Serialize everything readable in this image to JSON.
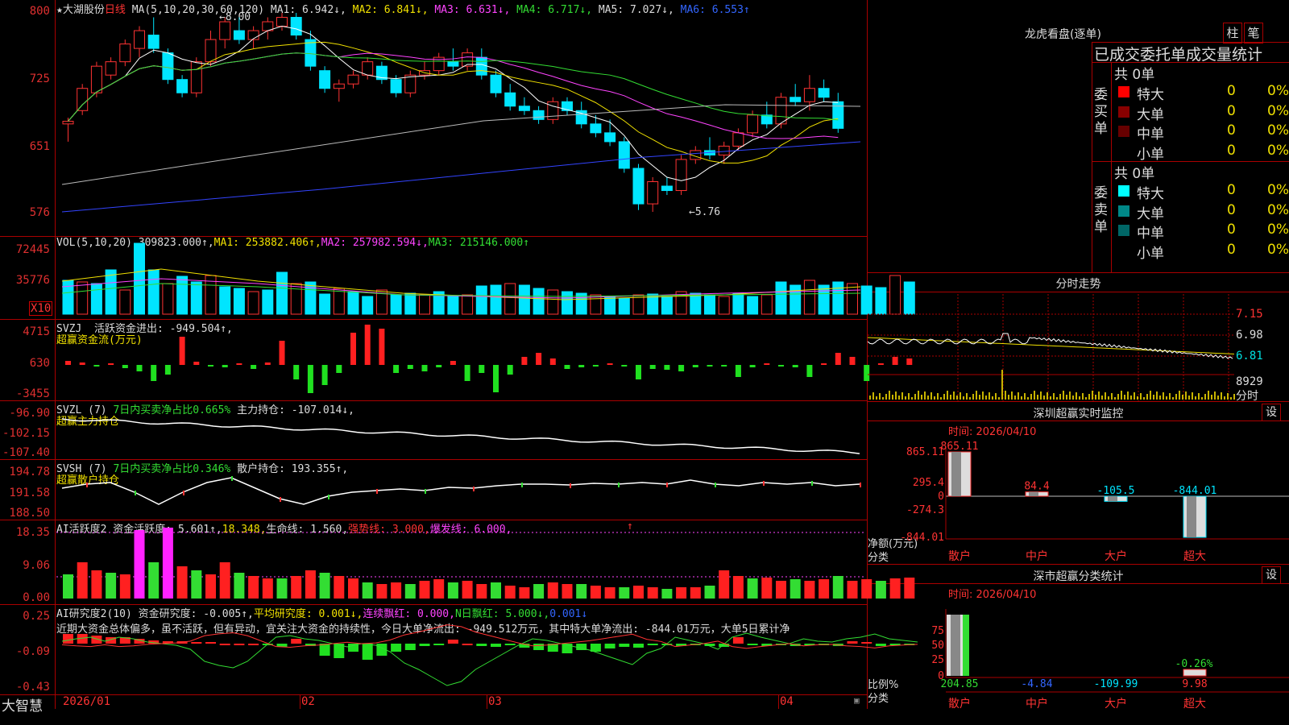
{
  "stock": {
    "star": "★",
    "name": "大湖股份",
    "period": "日线"
  },
  "main_panel": {
    "y_labels": [
      "800",
      "725",
      "651",
      "576"
    ],
    "ma_title": "MA(5,10,20,30,60,120)",
    "ma1": "MA1: 6.942↓,",
    "ma2": "MA2: 6.841↓,",
    "ma3": "MA3: 6.631↓,",
    "ma4": "MA4: 6.717↓,",
    "ma5": "MA5: 7.027↓,",
    "ma6": "MA6: 6.553↑",
    "high_label": "8.00",
    "low_label": "5.76"
  },
  "vol_panel": {
    "y_labels": [
      "72445",
      "35776"
    ],
    "unit": "X10",
    "title": "VOL(5,10,20) 309823.000↑,",
    "ma1": "MA1: 253882.406↑,",
    "ma2": "MA2: 257982.594↓,",
    "ma3": "MA3: 215146.000↑"
  },
  "svzj_panel": {
    "y_labels": [
      "4715",
      "630",
      "-3455"
    ],
    "title": "SVZJ  活跃资金进出: -949.504↑,",
    "sub": "超赢资金流(万元)"
  },
  "svzl_panel": {
    "y_labels": [
      "-96.90",
      "-102.15",
      "-107.40"
    ],
    "title_a": "SVZL (7) ",
    "title_b": "7日内买卖净占比0.665%",
    "title_c": " 主力持仓: -107.014↓,",
    "sub": "超赢主力持仓"
  },
  "svsh_panel": {
    "y_labels": [
      "194.78",
      "191.58",
      "188.50"
    ],
    "title_a": "SVSH (7) ",
    "title_b": "7日内买卖净占比0.346%",
    "title_c": " 散户持仓: 193.355↑,",
    "sub": "超赢散户持仓"
  },
  "ai_active_panel": {
    "y_labels": [
      "18.35",
      "9.06",
      "0.00"
    ],
    "t1": "AI活跃度2 资金活跃度: 5.601↑,",
    "t2": "18.348,",
    "t3": "生命线: 1.560,",
    "t4": "强势线: 3.000,",
    "t5": "爆发线: 6.000,",
    "t6": "↑"
  },
  "ai_research_panel": {
    "y_labels": [
      "0.25",
      "-0.09",
      "-0.43"
    ],
    "t1": "AI研究度2(10) 资金研究度: -0.005↑,",
    "t2": "平均研究度: 0.001↓,",
    "t3": "连续飘红: 0.000,",
    "t4": "N日飘红: 5.000↓,",
    "t5": "0.001↓",
    "comment": "近期大资金总体偏多，虽不活跃，但有异动，宜关注大资金的持续性，今日大单净流出: -949.512万元，其中特大单净流出: -844.01万元，大单5日累计净"
  },
  "x_axis": {
    "labels": [
      "2026/01",
      "02",
      "03",
      "04"
    ],
    "app_name": "大智慧"
  },
  "dragon_tiger": {
    "title": "龙虎看盘(逐单)",
    "tab_bar": "柱",
    "tab_stroke": "笔",
    "header": "已成交委托单成交量统计",
    "buy_label": "委买单",
    "sell_label": "委卖单",
    "buy_total": "共 0单",
    "sell_total": "共 0单",
    "buy_rows": [
      {
        "name": "特大",
        "vol": "0",
        "pct": "0%",
        "color": "#ff0000"
      },
      {
        "name": "大单",
        "vol": "0",
        "pct": "0%",
        "color": "#880000"
      },
      {
        "name": "中单",
        "vol": "0",
        "pct": "0%",
        "color": "#660000"
      },
      {
        "name": "小单",
        "vol": "0",
        "pct": "0%",
        "color": "#000000"
      }
    ],
    "sell_rows": [
      {
        "name": "特大",
        "vol": "0",
        "pct": "0%",
        "color": "#00ffff"
      },
      {
        "name": "大单",
        "vol": "0",
        "pct": "0%",
        "color": "#008888"
      },
      {
        "name": "中单",
        "vol": "0",
        "pct": "0%",
        "color": "#006666"
      },
      {
        "name": "小单",
        "vol": "0",
        "pct": "0%",
        "color": "#000000"
      }
    ]
  },
  "intraday": {
    "title": "分时走势",
    "y_labels": [
      "7.15",
      "6.98",
      "6.81"
    ],
    "vol_label": "8929",
    "vol_unit": "分时"
  },
  "sz_monitor": {
    "title": "深圳超赢实时监控",
    "gear": "设",
    "time": "时间: 2026/04/10",
    "y_labels": [
      "865.11",
      "295.4",
      "0",
      "-274.3",
      "-844.01"
    ],
    "axis_title": "净额(万元)",
    "axis_cat": "分类",
    "categories": [
      "散户",
      "中户",
      "大户",
      "超大"
    ],
    "values": [
      865.11,
      84.4,
      -105.5,
      -844.01
    ],
    "value_labels": [
      "865.11",
      "84.4",
      "-105.5",
      "-844.01"
    ]
  },
  "sz_stats": {
    "title": "深市超赢分类统计",
    "gear": "设",
    "time": "时间: 2026/04/10",
    "y_labels": [
      "75",
      "50",
      "25",
      "0"
    ],
    "axis_title": "比例%",
    "axis_cat": "分类",
    "categories": [
      "散户",
      "中户",
      "大户",
      "超大"
    ],
    "values": [
      204.85,
      -4.84,
      -109.99,
      9.98
    ],
    "value_labels": [
      "204.85",
      "-4.84",
      "-109.99",
      "9.98"
    ],
    "extra_label": "-0.26%"
  },
  "chart_data": [
    {
      "type": "candlestick",
      "title": "大湖股份 日线",
      "ylim": [
        5.6,
        8.1
      ],
      "y_ticks": [
        8.0,
        7.25,
        6.51,
        5.76
      ],
      "ohlc": [
        [
          6.75,
          6.82,
          6.55,
          6.78
        ],
        [
          6.9,
          7.2,
          6.85,
          7.15
        ],
        [
          7.1,
          7.45,
          7.05,
          7.4
        ],
        [
          7.3,
          7.5,
          7.25,
          7.45
        ],
        [
          7.45,
          7.7,
          7.4,
          7.65
        ],
        [
          7.6,
          7.85,
          7.5,
          7.8
        ],
        [
          7.75,
          7.95,
          7.55,
          7.6
        ],
        [
          7.55,
          7.6,
          7.2,
          7.25
        ],
        [
          7.25,
          7.3,
          7.05,
          7.1
        ],
        [
          7.1,
          7.5,
          7.05,
          7.45
        ],
        [
          7.45,
          7.8,
          7.4,
          7.7
        ],
        [
          7.7,
          7.95,
          7.6,
          7.9
        ],
        [
          7.8,
          7.95,
          7.65,
          7.7
        ],
        [
          7.7,
          7.85,
          7.6,
          7.8
        ],
        [
          7.8,
          7.95,
          7.7,
          7.9
        ],
        [
          7.85,
          8.0,
          7.8,
          7.95
        ],
        [
          7.95,
          8.0,
          7.7,
          7.75
        ],
        [
          7.7,
          7.8,
          7.35,
          7.4
        ],
        [
          7.35,
          7.4,
          7.1,
          7.15
        ],
        [
          7.15,
          7.25,
          7.0,
          7.2
        ],
        [
          7.2,
          7.35,
          7.15,
          7.3
        ],
        [
          7.3,
          7.5,
          7.25,
          7.45
        ],
        [
          7.4,
          7.45,
          7.2,
          7.25
        ],
        [
          7.25,
          7.3,
          7.05,
          7.1
        ],
        [
          7.1,
          7.35,
          7.05,
          7.3
        ],
        [
          7.3,
          7.45,
          7.25,
          7.35
        ],
        [
          7.35,
          7.55,
          7.3,
          7.5
        ],
        [
          7.45,
          7.6,
          7.35,
          7.4
        ],
        [
          7.4,
          7.6,
          7.35,
          7.55
        ],
        [
          7.5,
          7.6,
          7.25,
          7.3
        ],
        [
          7.3,
          7.35,
          7.05,
          7.1
        ],
        [
          7.1,
          7.2,
          6.9,
          6.95
        ],
        [
          6.95,
          7.05,
          6.85,
          6.9
        ],
        [
          6.9,
          6.95,
          6.75,
          6.8
        ],
        [
          6.8,
          7.05,
          6.75,
          7.0
        ],
        [
          7.0,
          7.05,
          6.85,
          6.9
        ],
        [
          6.9,
          7.0,
          6.7,
          6.75
        ],
        [
          6.75,
          6.85,
          6.6,
          6.65
        ],
        [
          6.65,
          6.8,
          6.5,
          6.55
        ],
        [
          6.55,
          6.6,
          6.2,
          6.25
        ],
        [
          6.25,
          6.3,
          5.78,
          5.85
        ],
        [
          5.85,
          6.15,
          5.76,
          6.1
        ],
        [
          6.05,
          6.15,
          5.95,
          6.0
        ],
        [
          6.0,
          6.4,
          5.95,
          6.35
        ],
        [
          6.35,
          6.5,
          6.3,
          6.45
        ],
        [
          6.45,
          6.6,
          6.35,
          6.4
        ],
        [
          6.4,
          6.55,
          6.3,
          6.5
        ],
        [
          6.5,
          6.7,
          6.45,
          6.65
        ],
        [
          6.65,
          6.9,
          6.6,
          6.85
        ],
        [
          6.85,
          7.0,
          6.7,
          6.75
        ],
        [
          6.75,
          7.1,
          6.7,
          7.05
        ],
        [
          7.05,
          7.2,
          6.95,
          7.0
        ],
        [
          7.0,
          7.3,
          6.9,
          7.15
        ],
        [
          7.15,
          7.25,
          7.0,
          7.05
        ],
        [
          7.0,
          7.1,
          6.65,
          6.7
        ]
      ]
    }
  ]
}
